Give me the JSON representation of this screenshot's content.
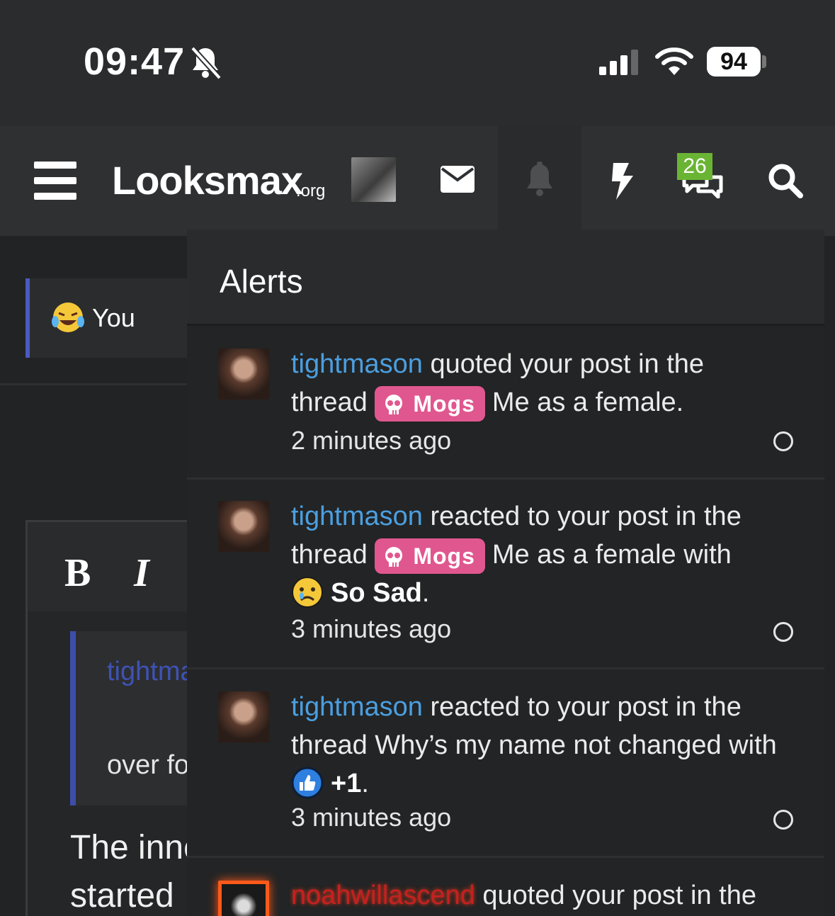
{
  "status_bar": {
    "time": "09:47",
    "bell_icon": "bell-slash-icon",
    "signal_icon": "cellular-signal-icon",
    "wifi_icon": "wifi-icon",
    "battery": "94"
  },
  "nav": {
    "menu_icon": "hamburger-icon",
    "logo": "Looksmax",
    "logo_suffix": ".org",
    "avatar": "user-avatar",
    "mail_icon": "envelope-icon",
    "bell_icon": "bell-icon",
    "bolt_icon": "lightning-icon",
    "conversations_icon": "chat-bubbles-icon",
    "conversations_badge": "26",
    "search_icon": "search-icon"
  },
  "background_page": {
    "reaction_label": "You",
    "quote_author": "tightma",
    "quote_text": "over fo",
    "body_line_1": "The inne",
    "body_line_2": "started"
  },
  "alerts": {
    "title": "Alerts",
    "items": [
      {
        "user": "tightmason",
        "action": " quoted your post in the thread ",
        "prefix": "Mogs",
        "thread": "Me as a female.",
        "reaction": "",
        "time": "2 minutes ago"
      },
      {
        "user": "tightmason",
        "action": " reacted to your post in the thread ",
        "prefix": "Mogs",
        "thread": "Me as a female with",
        "reaction": "So Sad",
        "reaction_icon": "sad-face-emoji",
        "time": "3 minutes ago"
      },
      {
        "user": "tightmason",
        "action": " reacted to your post in the thread Why’s my name not changed with",
        "prefix": "",
        "thread": "",
        "reaction": "+1",
        "reaction_icon": "thumbs-up-icon",
        "time": "3 minutes ago"
      },
      {
        "user": "noahwillascend",
        "action": " quoted your post in the",
        "time": ""
      }
    ]
  }
}
